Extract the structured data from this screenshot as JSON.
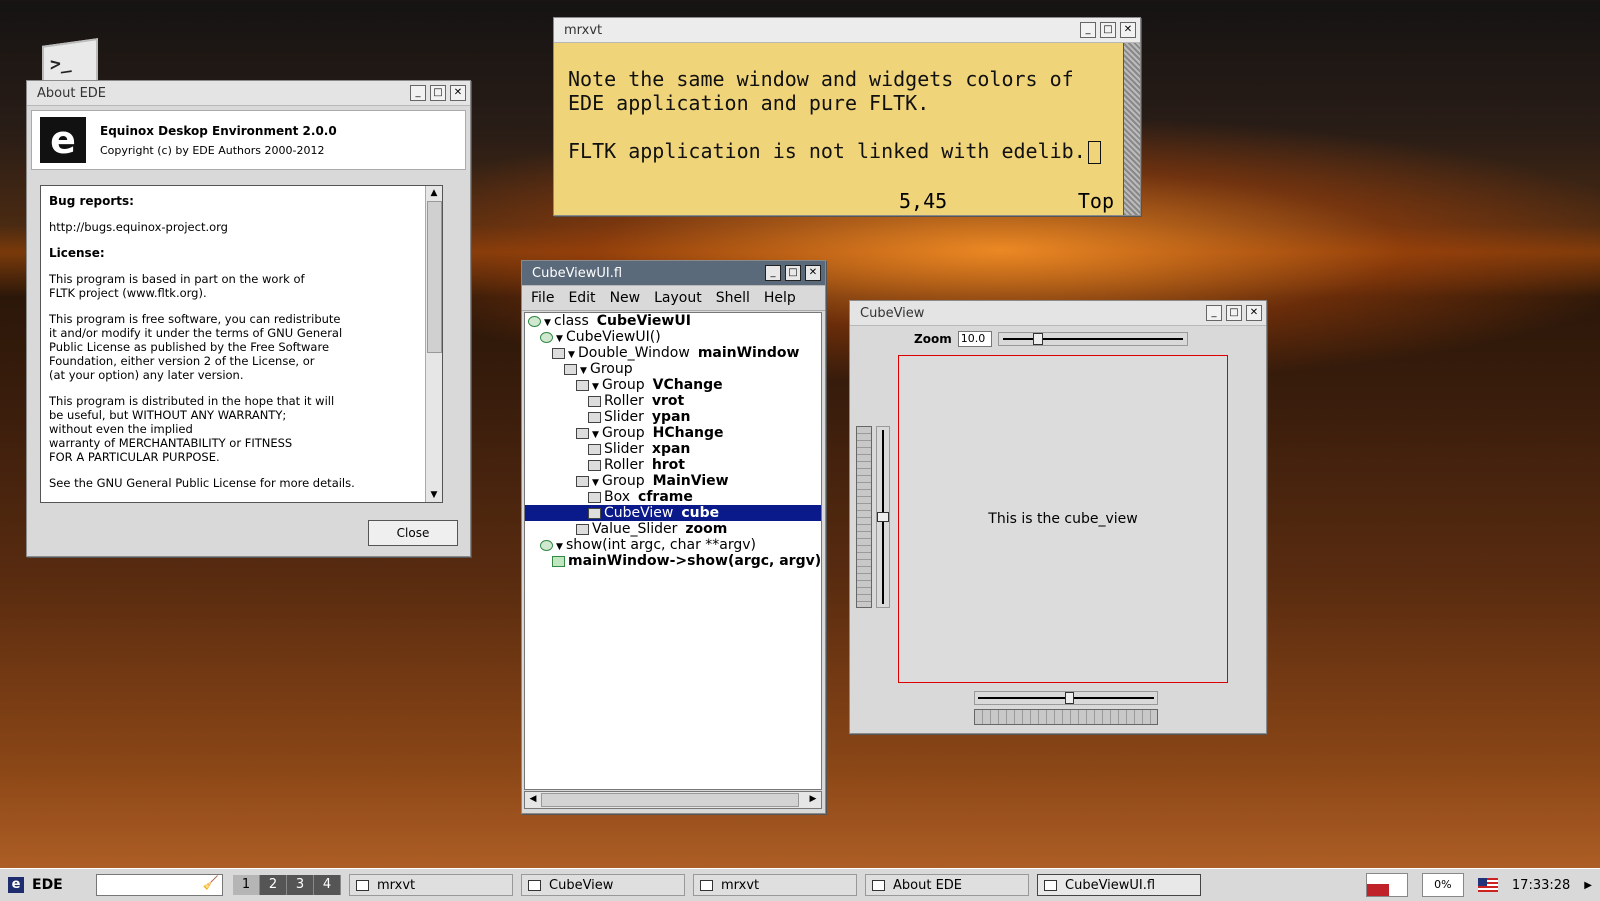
{
  "desktop": {
    "terminal_icon_glyph": ">_"
  },
  "about": {
    "title": "About EDE",
    "logo_letter": "e",
    "app_name": "Equinox Deskop Environment 2.0.0",
    "copyright": "Copyright (c) by EDE Authors 2000-2012",
    "bug_heading": "Bug reports:",
    "bug_url": "http://bugs.equinox-project.org",
    "license_heading": "License:",
    "para1": "This program is based in part on the work of\nFLTK project (www.fltk.org).",
    "para2": "This program is free software, you can redistribute\nit and/or modify it under the terms of GNU General\nPublic License as published by the Free Software\nFoundation, either version 2 of the License, or\n(at your option) any later version.",
    "para3": "This program is distributed in the hope that it will\nbe useful, but WITHOUT ANY WARRANTY;\nwithout even the implied\nwarranty of MERCHANTABILITY or FITNESS\nFOR A PARTICULAR PURPOSE.",
    "para4": "See the GNU General Public License for more details.",
    "close_label": "Close"
  },
  "mrxvt": {
    "title": "mrxvt",
    "line1": "Note the same window and widgets colors of",
    "line2": "EDE application and pure FLTK.",
    "line3": "FLTK application is not linked with edelib.",
    "position": "5,45",
    "scroll_pos": "Top"
  },
  "fluid": {
    "title": "CubeViewUI.fl",
    "menu": [
      "File",
      "Edit",
      "New",
      "Layout",
      "Shell",
      "Help"
    ],
    "tree": [
      {
        "indent": 0,
        "icon": "oval",
        "expand": true,
        "type": "class",
        "name": "CubeViewUI"
      },
      {
        "indent": 1,
        "icon": "oval",
        "expand": true,
        "type": "CubeViewUI()",
        "name": ""
      },
      {
        "indent": 2,
        "icon": "window",
        "expand": true,
        "type": "Double_Window",
        "name": "mainWindow"
      },
      {
        "indent": 3,
        "icon": "group",
        "expand": true,
        "type": "Group",
        "name": ""
      },
      {
        "indent": 4,
        "icon": "group",
        "expand": true,
        "type": "Group",
        "name": "VChange"
      },
      {
        "indent": 5,
        "icon": "roller",
        "expand": false,
        "type": "Roller",
        "name": "vrot"
      },
      {
        "indent": 5,
        "icon": "slider",
        "expand": false,
        "type": "Slider",
        "name": "ypan"
      },
      {
        "indent": 4,
        "icon": "group",
        "expand": true,
        "type": "Group",
        "name": "HChange"
      },
      {
        "indent": 5,
        "icon": "slider",
        "expand": false,
        "type": "Slider",
        "name": "xpan"
      },
      {
        "indent": 5,
        "icon": "roller",
        "expand": false,
        "type": "Roller",
        "name": "hrot"
      },
      {
        "indent": 4,
        "icon": "group",
        "expand": true,
        "type": "Group",
        "name": "MainView"
      },
      {
        "indent": 5,
        "icon": "box",
        "expand": false,
        "type": "Box",
        "name": "cframe"
      },
      {
        "indent": 5,
        "icon": "box",
        "expand": false,
        "type": "CubeView",
        "name": "cube",
        "selected": true
      },
      {
        "indent": 4,
        "icon": "slider",
        "expand": false,
        "type": "Value_Slider",
        "name": "zoom"
      },
      {
        "indent": 1,
        "icon": "oval",
        "expand": true,
        "type": "show(int argc, char **argv)",
        "name": ""
      },
      {
        "indent": 2,
        "icon": "code",
        "expand": false,
        "type": "",
        "name": "mainWindow->show(argc, argv);"
      }
    ]
  },
  "cubeview": {
    "title": "CubeView",
    "zoom_label": "Zoom",
    "zoom_value": "10.0",
    "zoom_fraction": 0.19,
    "view_text": "This is the cube_view"
  },
  "taskbar": {
    "start_label": "EDE",
    "workspaces": [
      "1",
      "2",
      "3",
      "4"
    ],
    "current_workspace": 0,
    "tasks": [
      {
        "label": "mrxvt",
        "active": false
      },
      {
        "label": "CubeView",
        "active": false
      },
      {
        "label": "mrxvt",
        "active": false
      },
      {
        "label": "About EDE",
        "active": false
      },
      {
        "label": "CubeViewUI.fl",
        "active": true
      }
    ],
    "cpu_label": "0%",
    "clock": "17:33:28"
  }
}
